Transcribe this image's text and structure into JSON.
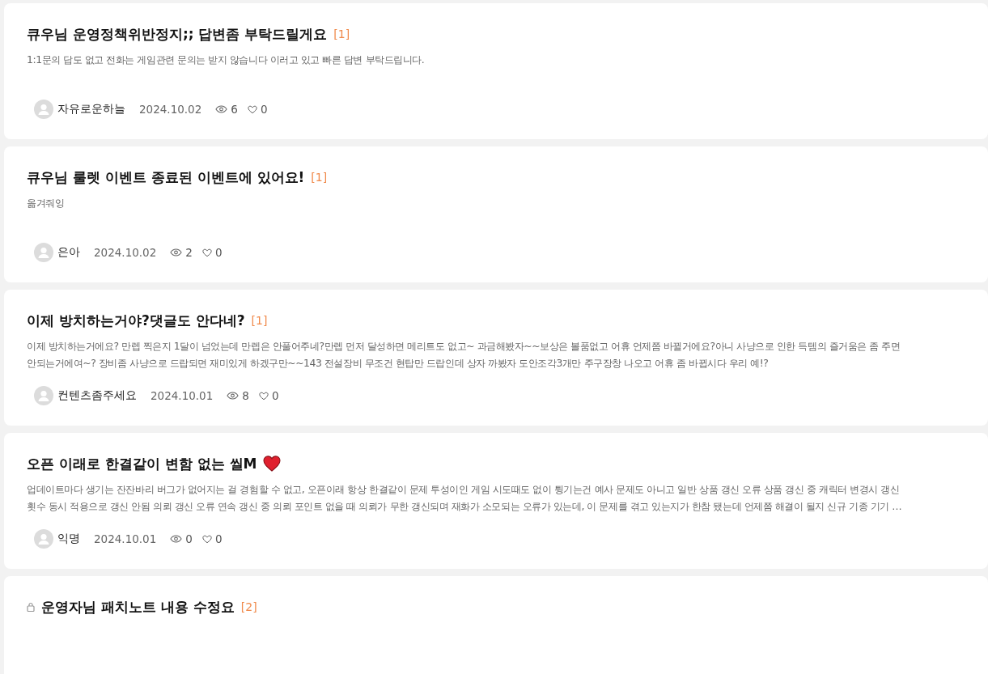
{
  "posts": [
    {
      "title": "큐우님 운영정책위반정지;; 답변좀 부탁드릴게요",
      "comment_count": "[1]",
      "locked": false,
      "heart": false,
      "body_lines": [
        "1:1문의 답도 없고 전화는 게임관련 문의는 받지 않습니다 이러고 있고 빠른 답변 부탁드립니다."
      ],
      "author": "자유로운하늘",
      "date": "2024.10.02",
      "views": "6",
      "likes": "0"
    },
    {
      "title": "큐우님 룰렛 이벤트 종료된 이벤트에 있어요!",
      "comment_count": "[1]",
      "locked": false,
      "heart": false,
      "body_lines": [
        "옮겨줘잉"
      ],
      "author": "은아",
      "date": "2024.10.02",
      "views": "2",
      "likes": "0"
    },
    {
      "title": "이제 방치하는거야?댓글도 안다네?",
      "comment_count": "[1]",
      "locked": false,
      "heart": false,
      "body_lines": [
        "이제 방치하는거에요? 만렙 찍은지 1달이 넘었는데 만렙은 안풀어주네?만렙 먼저 달성하면 메리트도 없고~ 과금해봤자~~보상은 볼품없고 어휴 언제쯤 바뀔거에요?아니 사냥으로 인한 득템의 즐거움은 좀 주면",
        "안되는거에여~? 장비좀 사냥으로 드랍되면 재미있게 하겠구만~~143 전설장비 무조건 현탑만 드랍인데 상자 까봤자 도안조각3개만 주구장창 나오고 어휴 좀 바뀝시다 우리 예!?"
      ],
      "author": "컨텐츠좀주세요",
      "date": "2024.10.01",
      "views": "8",
      "likes": "0"
    },
    {
      "title": "오픈 이래로 한결같이 변함 없는 씰M",
      "locked": false,
      "heart": true,
      "body_lines": [
        "업데이트마다 생기는 잔잔바리 버그가 없어지는 걸 경험할 수 없고, 오픈이래 항상 한결같이 문제 투성이인 게임 시도때도 없이 튕기는건 예사 문제도 아니고 일반 상품 갱신 오류 상품 갱신 중 캐릭터 변경시 갱신",
        "횟수 동시 적용으로 갱신 안됨 의뢰 갱신 오류 연속 갱신 중 의뢰 포인트 없을 때 의뢰가 무한 갱신되며 재화가 소모되는 오류가 있는데, 이 문제를 겪고 있는지가 한참 됐는데 언제쯤 해결이 될지 신규 기종 기기 …"
      ],
      "author": "익명",
      "date": "2024.10.01",
      "views": "0",
      "likes": "0"
    },
    {
      "title": "운영자님 패치노트 내용 수정요",
      "comment_count": "[2]",
      "locked": true,
      "heart": false
    }
  ]
}
